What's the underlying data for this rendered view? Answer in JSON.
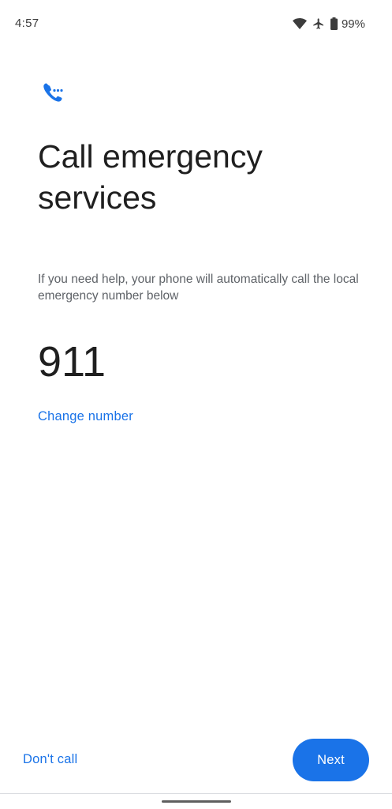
{
  "status_bar": {
    "time": "4:57",
    "battery_percent": "99%",
    "icons": [
      "wifi-icon",
      "airplane-icon",
      "battery-icon"
    ]
  },
  "main": {
    "header_icon": "phone-call-icon",
    "title": "Call emergency services",
    "description": "If you need help, your phone will automatically call the local emergency number below",
    "emergency_number": "911",
    "change_number_label": "Change number"
  },
  "footer": {
    "dont_call_label": "Don't call",
    "next_label": "Next"
  },
  "colors": {
    "accent": "#1a73e8",
    "text_primary": "#1f1f1f",
    "text_secondary": "#5f6368",
    "background": "#ffffff"
  }
}
